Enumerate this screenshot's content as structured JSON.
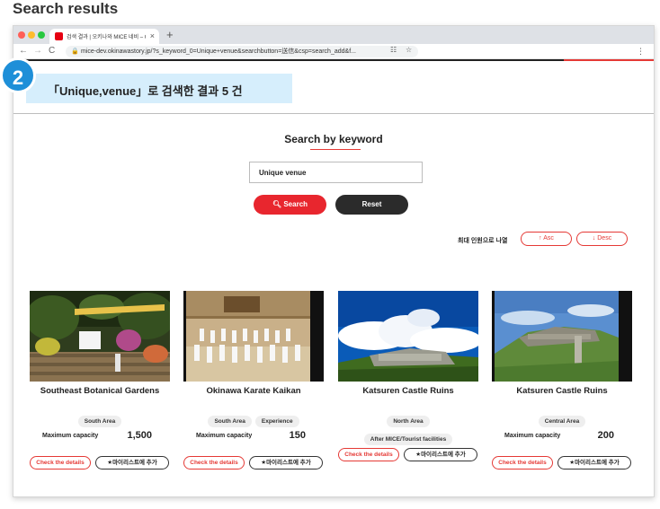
{
  "page": {
    "heading": "Search results"
  },
  "browser": {
    "tab_title": "검색 결과 | 오키나와 MICE 네비 – O",
    "tab_close": "×",
    "new_tab": "+",
    "url": "mice-dev.okinawastory.jp/?s_keyword_0=Unique+venue&searchbutton=送信&csp=search_add&f...",
    "back": "←",
    "forward": "→",
    "reload": "C",
    "menu": "⋮"
  },
  "step_badge": "2",
  "result_banner": "「Unique,venue」로 검색한 결과 5 건",
  "search": {
    "title": "Search by keyword",
    "input_value": "Unique venue",
    "search_label": "Search",
    "reset_label": "Reset"
  },
  "sort": {
    "label": "최대 인원으로 나열",
    "asc_label": "Asc",
    "desc_label": "Desc"
  },
  "cards": [
    {
      "name": "Southeast Botanical Gardens",
      "tags": [
        "South Area"
      ],
      "capacity_label": "Maximum capacity",
      "capacity": "1,500",
      "details_label": "Check the details",
      "add_label": "★마이리스트에 추가"
    },
    {
      "name": "Okinawa Karate Kaikan",
      "tags": [
        "South Area",
        "Experience"
      ],
      "capacity_label": "Maximum capacity",
      "capacity": "150",
      "details_label": "Check the details",
      "add_label": "★마이리스트에 추가"
    },
    {
      "name": "Katsuren Castle Ruins",
      "tags": [
        "North Area",
        "After MICE/Tourist facilities"
      ],
      "capacity_label": "",
      "capacity": "",
      "details_label": "Check the details",
      "add_label": "★마이리스트에 추가"
    },
    {
      "name": "Katsuren Castle Ruins",
      "tags": [
        "Central Area"
      ],
      "capacity_label": "Maximum capacity",
      "capacity": "200",
      "details_label": "Check the details",
      "add_label": "★마이리스트에 추가"
    }
  ],
  "colors": {
    "accent_red": "#e8262e",
    "banner_blue": "#d6eefc",
    "badge_blue": "#1e8fd8"
  }
}
